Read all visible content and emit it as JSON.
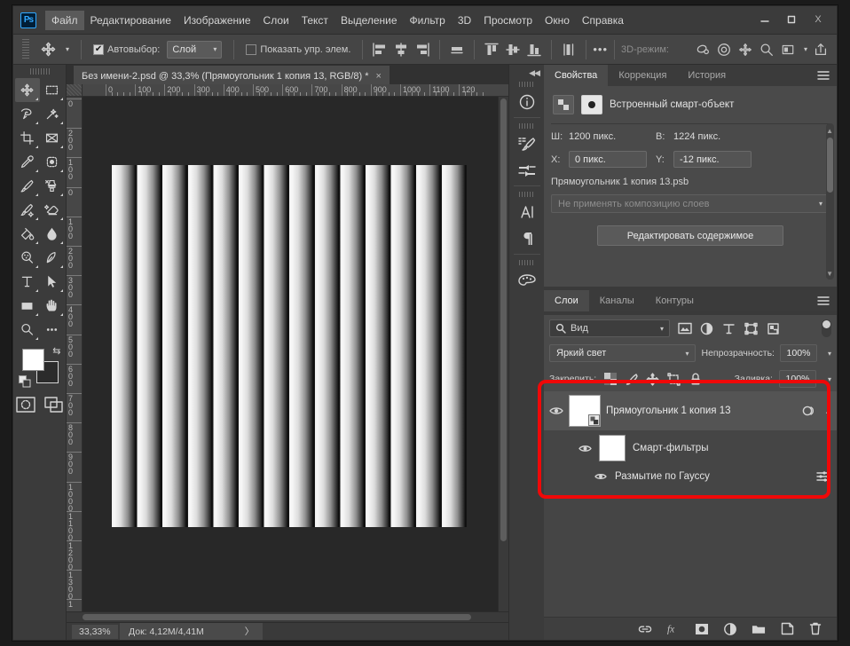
{
  "window": {
    "app_name": "Ps",
    "controls": {
      "minimize": "–",
      "maximize": "▢",
      "close": "X"
    }
  },
  "menu": [
    {
      "label": "Файл"
    },
    {
      "label": "Редактирование"
    },
    {
      "label": "Изображение"
    },
    {
      "label": "Слои"
    },
    {
      "label": "Текст"
    },
    {
      "label": "Выделение"
    },
    {
      "label": "Фильтр"
    },
    {
      "label": "3D"
    },
    {
      "label": "Просмотр"
    },
    {
      "label": "Окно"
    },
    {
      "label": "Справка"
    }
  ],
  "options_bar": {
    "tool_icon": "move-tool-icon",
    "autoselect_label": "Автовыбор:",
    "autoselect_checked": true,
    "scope_value": "Слой",
    "show_controls_label": "Показать упр. элем.",
    "show_controls_checked": false,
    "mode3d_label": "3D-режим:",
    "more_label": "•••"
  },
  "document": {
    "tab_title": "Без имени-2.psd @ 33,3% (Прямоугольник 1 копия 13, RGB/8) *",
    "close_label": "×",
    "ruler_h_labels": [
      "0",
      "100",
      "200",
      "300",
      "400",
      "500",
      "600",
      "700",
      "800",
      "900",
      "1000",
      "1100",
      "120"
    ],
    "ruler_v_labels": [
      "0",
      "200",
      "100",
      "0",
      "100",
      "200",
      "300",
      "400",
      "500",
      "600",
      "700",
      "800",
      "900",
      "1000",
      "1100",
      "1200",
      "1300",
      "1"
    ]
  },
  "status_bar": {
    "zoom": "33,33%",
    "doc_info": "Док: 4,12M/4,41M",
    "expand_arrow": "〉"
  },
  "icon_strip": [
    {
      "name": "info-icon"
    },
    {
      "name": "brush-presets-icon"
    },
    {
      "name": "adjustments-icon"
    },
    {
      "name": "character-icon"
    },
    {
      "name": "paragraph-icon"
    },
    {
      "name": "swatches-icon"
    }
  ],
  "properties_panel": {
    "tabs": [
      {
        "label": "Свойства",
        "active": true
      },
      {
        "label": "Коррекция",
        "active": false
      },
      {
        "label": "История",
        "active": false
      }
    ],
    "header_title": "Встроенный смарт-объект",
    "width_label": "Ш:",
    "width_value": "1200 пикс.",
    "height_label": "В:",
    "height_value": "1224 пикс.",
    "x_label": "X:",
    "x_value": "0 пикс.",
    "y_label": "Y:",
    "y_value": "-12 пикс.",
    "psb_name": "Прямоугольник 1 копия 13.psb",
    "layer_comp_placeholder": "Не применять композицию слоев",
    "edit_contents_button": "Редактировать содержимое"
  },
  "layers_panel": {
    "tabs": [
      {
        "label": "Слои",
        "active": true
      },
      {
        "label": "Каналы",
        "active": false
      },
      {
        "label": "Контуры",
        "active": false
      }
    ],
    "filter_kind_value": "Вид",
    "filter_icons": [
      "pixel-filter-icon",
      "adjustment-filter-icon",
      "type-filter-icon",
      "shape-filter-icon",
      "smart-object-filter-icon"
    ],
    "blend_mode": "Яркий свет",
    "opacity_label": "Непрозрачность:",
    "opacity_value": "100%",
    "lock_label": "Закрепить:",
    "lock_icons": [
      "lock-transparency-icon",
      "lock-image-icon",
      "lock-position-icon",
      "lock-artboard-icon",
      "lock-all-icon"
    ],
    "fill_label": "Заливка:",
    "fill_value": "100%",
    "layers": [
      {
        "name": "Прямоугольник 1 копия 13",
        "visible": true,
        "selected": true,
        "type": "smart-object"
      }
    ],
    "smart_filters": {
      "label": "Смарт-фильтры",
      "visible": true,
      "effects": [
        {
          "label": "Размытие по Гауссу",
          "visible": true
        }
      ]
    },
    "footer_icons": [
      "link-layers-icon",
      "layer-style-fx-icon",
      "add-mask-icon",
      "adjustment-layer-icon",
      "new-group-icon",
      "new-layer-icon",
      "delete-layer-icon"
    ]
  },
  "toolbar": {
    "tools": [
      {
        "name": "move-tool-icon",
        "selected": true
      },
      {
        "name": "rectangular-marquee-tool-icon",
        "selected": false
      },
      {
        "name": "lasso-tool-icon",
        "selected": false
      },
      {
        "name": "magic-wand-tool-icon",
        "selected": false
      },
      {
        "name": "crop-tool-icon",
        "selected": false
      },
      {
        "name": "frame-tool-icon",
        "selected": false
      },
      {
        "name": "eyedropper-tool-icon",
        "selected": false
      },
      {
        "name": "spot-healing-brush-tool-icon",
        "selected": false
      },
      {
        "name": "brush-tool-icon",
        "selected": false
      },
      {
        "name": "clone-stamp-tool-icon",
        "selected": false
      },
      {
        "name": "history-brush-tool-icon",
        "selected": false
      },
      {
        "name": "eraser-tool-icon",
        "selected": false
      },
      {
        "name": "gradient-tool-icon",
        "selected": false
      },
      {
        "name": "blur-tool-icon",
        "selected": false
      },
      {
        "name": "dodge-tool-icon",
        "selected": false
      },
      {
        "name": "pen-tool-icon",
        "selected": false
      },
      {
        "name": "type-tool-icon",
        "selected": false
      },
      {
        "name": "path-selection-tool-icon",
        "selected": false
      },
      {
        "name": "rectangle-tool-icon",
        "selected": false
      },
      {
        "name": "hand-tool-icon",
        "selected": false
      },
      {
        "name": "zoom-tool-icon",
        "selected": false
      },
      {
        "name": "edit-toolbar-icon",
        "selected": false
      }
    ],
    "foreground_color": "#ffffff",
    "background_color": "#2b2b2b",
    "quickmask_icon": "quick-mask-icon",
    "screenmode_icon": "screen-mode-icon"
  },
  "annotation": {
    "color": "#f00808",
    "shape": "rounded-rectangle"
  }
}
